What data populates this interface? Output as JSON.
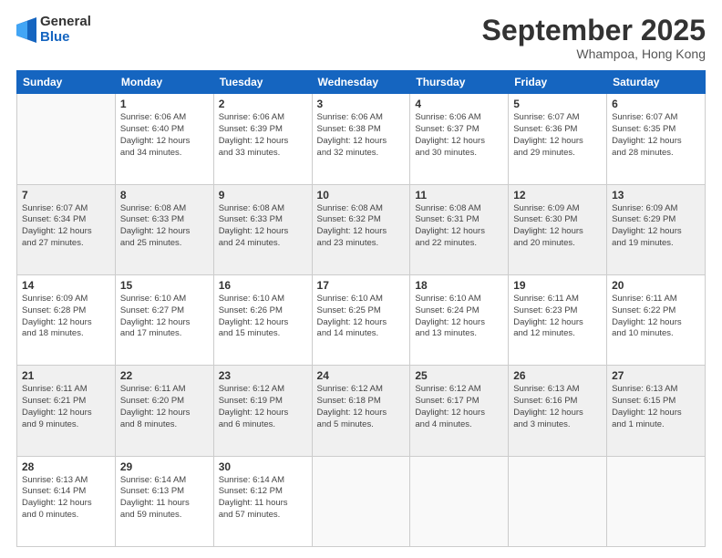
{
  "logo": {
    "general": "General",
    "blue": "Blue"
  },
  "title": "September 2025",
  "location": "Whampoa, Hong Kong",
  "days_header": [
    "Sunday",
    "Monday",
    "Tuesday",
    "Wednesday",
    "Thursday",
    "Friday",
    "Saturday"
  ],
  "weeks": [
    [
      {
        "num": "",
        "info": ""
      },
      {
        "num": "1",
        "info": "Sunrise: 6:06 AM\nSunset: 6:40 PM\nDaylight: 12 hours\nand 34 minutes."
      },
      {
        "num": "2",
        "info": "Sunrise: 6:06 AM\nSunset: 6:39 PM\nDaylight: 12 hours\nand 33 minutes."
      },
      {
        "num": "3",
        "info": "Sunrise: 6:06 AM\nSunset: 6:38 PM\nDaylight: 12 hours\nand 32 minutes."
      },
      {
        "num": "4",
        "info": "Sunrise: 6:06 AM\nSunset: 6:37 PM\nDaylight: 12 hours\nand 30 minutes."
      },
      {
        "num": "5",
        "info": "Sunrise: 6:07 AM\nSunset: 6:36 PM\nDaylight: 12 hours\nand 29 minutes."
      },
      {
        "num": "6",
        "info": "Sunrise: 6:07 AM\nSunset: 6:35 PM\nDaylight: 12 hours\nand 28 minutes."
      }
    ],
    [
      {
        "num": "7",
        "info": "Sunrise: 6:07 AM\nSunset: 6:34 PM\nDaylight: 12 hours\nand 27 minutes."
      },
      {
        "num": "8",
        "info": "Sunrise: 6:08 AM\nSunset: 6:33 PM\nDaylight: 12 hours\nand 25 minutes."
      },
      {
        "num": "9",
        "info": "Sunrise: 6:08 AM\nSunset: 6:33 PM\nDaylight: 12 hours\nand 24 minutes."
      },
      {
        "num": "10",
        "info": "Sunrise: 6:08 AM\nSunset: 6:32 PM\nDaylight: 12 hours\nand 23 minutes."
      },
      {
        "num": "11",
        "info": "Sunrise: 6:08 AM\nSunset: 6:31 PM\nDaylight: 12 hours\nand 22 minutes."
      },
      {
        "num": "12",
        "info": "Sunrise: 6:09 AM\nSunset: 6:30 PM\nDaylight: 12 hours\nand 20 minutes."
      },
      {
        "num": "13",
        "info": "Sunrise: 6:09 AM\nSunset: 6:29 PM\nDaylight: 12 hours\nand 19 minutes."
      }
    ],
    [
      {
        "num": "14",
        "info": "Sunrise: 6:09 AM\nSunset: 6:28 PM\nDaylight: 12 hours\nand 18 minutes."
      },
      {
        "num": "15",
        "info": "Sunrise: 6:10 AM\nSunset: 6:27 PM\nDaylight: 12 hours\nand 17 minutes."
      },
      {
        "num": "16",
        "info": "Sunrise: 6:10 AM\nSunset: 6:26 PM\nDaylight: 12 hours\nand 15 minutes."
      },
      {
        "num": "17",
        "info": "Sunrise: 6:10 AM\nSunset: 6:25 PM\nDaylight: 12 hours\nand 14 minutes."
      },
      {
        "num": "18",
        "info": "Sunrise: 6:10 AM\nSunset: 6:24 PM\nDaylight: 12 hours\nand 13 minutes."
      },
      {
        "num": "19",
        "info": "Sunrise: 6:11 AM\nSunset: 6:23 PM\nDaylight: 12 hours\nand 12 minutes."
      },
      {
        "num": "20",
        "info": "Sunrise: 6:11 AM\nSunset: 6:22 PM\nDaylight: 12 hours\nand 10 minutes."
      }
    ],
    [
      {
        "num": "21",
        "info": "Sunrise: 6:11 AM\nSunset: 6:21 PM\nDaylight: 12 hours\nand 9 minutes."
      },
      {
        "num": "22",
        "info": "Sunrise: 6:11 AM\nSunset: 6:20 PM\nDaylight: 12 hours\nand 8 minutes."
      },
      {
        "num": "23",
        "info": "Sunrise: 6:12 AM\nSunset: 6:19 PM\nDaylight: 12 hours\nand 6 minutes."
      },
      {
        "num": "24",
        "info": "Sunrise: 6:12 AM\nSunset: 6:18 PM\nDaylight: 12 hours\nand 5 minutes."
      },
      {
        "num": "25",
        "info": "Sunrise: 6:12 AM\nSunset: 6:17 PM\nDaylight: 12 hours\nand 4 minutes."
      },
      {
        "num": "26",
        "info": "Sunrise: 6:13 AM\nSunset: 6:16 PM\nDaylight: 12 hours\nand 3 minutes."
      },
      {
        "num": "27",
        "info": "Sunrise: 6:13 AM\nSunset: 6:15 PM\nDaylight: 12 hours\nand 1 minute."
      }
    ],
    [
      {
        "num": "28",
        "info": "Sunrise: 6:13 AM\nSunset: 6:14 PM\nDaylight: 12 hours\nand 0 minutes."
      },
      {
        "num": "29",
        "info": "Sunrise: 6:14 AM\nSunset: 6:13 PM\nDaylight: 11 hours\nand 59 minutes."
      },
      {
        "num": "30",
        "info": "Sunrise: 6:14 AM\nSunset: 6:12 PM\nDaylight: 11 hours\nand 57 minutes."
      },
      {
        "num": "",
        "info": ""
      },
      {
        "num": "",
        "info": ""
      },
      {
        "num": "",
        "info": ""
      },
      {
        "num": "",
        "info": ""
      }
    ]
  ]
}
